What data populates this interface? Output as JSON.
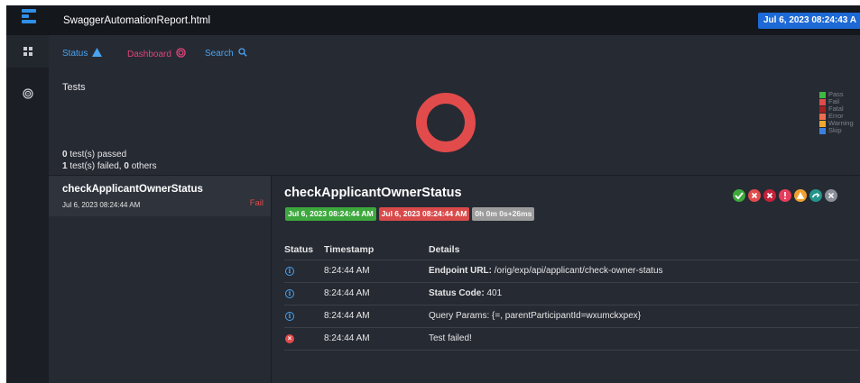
{
  "app": {
    "title": "SwaggerAutomationReport.html",
    "timestamp": "Jul 6, 2023 08:24:43 A"
  },
  "sidebar": {
    "items": [
      {
        "icon": "dashboard-grid-icon"
      },
      {
        "icon": "spiral-icon"
      }
    ]
  },
  "nav": {
    "status": {
      "label": "Status",
      "icon": "warning-triangle-icon",
      "color": "#4aa3f0"
    },
    "dashboard": {
      "label": "Dashboard",
      "icon": "spiral-icon",
      "color": "#e0457a"
    },
    "search": {
      "label": "Search",
      "icon": "search-icon",
      "color": "#4aa3f0"
    }
  },
  "dashboard": {
    "title": "Tests",
    "passed": {
      "count": "0",
      "text": " test(s) passed"
    },
    "failed": {
      "count": "1",
      "text": " test(s) failed, ",
      "others": "0",
      "others_text": " others"
    }
  },
  "chart_data": {
    "type": "pie",
    "categories": [
      "Pass",
      "Fail",
      "Fatal",
      "Error",
      "Warning",
      "Skip"
    ],
    "values": [
      0,
      1,
      0,
      0,
      0,
      0
    ],
    "colors": [
      "#40b840",
      "#e14b4b",
      "#a22020",
      "#ef6d4f",
      "#f0a830",
      "#3a80e0"
    ],
    "legend_position": "right"
  },
  "tests": [
    {
      "name": "checkApplicantOwnerStatus",
      "time": "Jul 6, 2023 08:24:44 AM",
      "status": "Fail"
    }
  ],
  "detail": {
    "title": "checkApplicantOwnerStatus",
    "start": "Jul 6, 2023 08:24:44 AM",
    "end": "Jul 6, 2023 08:24:44 AM",
    "duration": "0h 0m 0s+26ms",
    "filters": [
      {
        "icon": "check-icon",
        "color": "#3da83d"
      },
      {
        "icon": "x-icon",
        "color": "#e14b4b"
      },
      {
        "icon": "x-icon",
        "color": "#c4213a"
      },
      {
        "icon": "exclamation-icon",
        "color": "#e63d5c"
      },
      {
        "icon": "warning-icon",
        "color": "#f0a030"
      },
      {
        "icon": "skip-icon",
        "color": "#23958a"
      },
      {
        "icon": "close-icon",
        "color": "#8a8f98"
      }
    ],
    "columns": [
      "Status",
      "Timestamp",
      "Details"
    ],
    "logs": [
      {
        "status": "info",
        "time": "8:24:44 AM",
        "label": "Endpoint URL:",
        "text": " /orig/exp/api/applicant/check-owner-status"
      },
      {
        "status": "info",
        "time": "8:24:44 AM",
        "label": "Status Code:",
        "text": " 401"
      },
      {
        "status": "info",
        "time": "8:24:44 AM",
        "label": "",
        "text": "Query Params: {=, parentParticipantId=wxumckxpex}"
      },
      {
        "status": "fail",
        "time": "8:24:44 AM",
        "label": "",
        "text": "Test failed!"
      }
    ]
  }
}
